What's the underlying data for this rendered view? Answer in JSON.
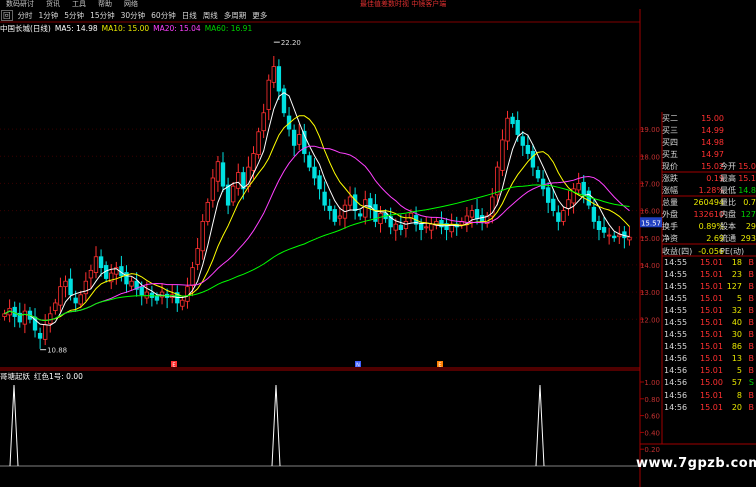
{
  "menubar": {
    "items": [
      "数码研讨",
      "货讯",
      "工具",
      "帮助",
      "网络"
    ],
    "ad_text": "最佳值差数时视 中镜客户端"
  },
  "periodbar": {
    "first": "回",
    "periods": [
      "分时",
      "1分钟",
      "5分钟",
      "15分钟",
      "30分钟",
      "60分钟",
      "日线",
      "周线",
      "多周期",
      "更多"
    ]
  },
  "title": {
    "stock": "中国长城(日线)",
    "ma5": "MA5: 14.98",
    "ma10": "MA10: 15.00",
    "ma20": "MA20: 15.04",
    "ma60": "MA60: 16.91"
  },
  "annotations": {
    "high": "22.20",
    "low": "10.88",
    "current_price_tag": "15.57"
  },
  "price_axis": [
    "19.00",
    "18.00",
    "17.00",
    "16.00",
    "15.00",
    "14.00",
    "13.00",
    "12.00"
  ],
  "indicator": {
    "name": "哥塘起妖",
    "signal": "红色1号: 0.00",
    "axis": [
      "1.00",
      "0.80",
      "0.60",
      "0.40",
      "0.20"
    ]
  },
  "event_marks": [
    "E",
    "N",
    "E"
  ],
  "chart_data": {
    "type": "candlestick",
    "series": [
      {
        "name": "MA5",
        "color": "#ffffff"
      },
      {
        "name": "MA10",
        "color": "#ffff00"
      },
      {
        "name": "MA20",
        "color": "#ff40ff"
      },
      {
        "name": "MA60",
        "color": "#00ff00"
      }
    ],
    "ylim": [
      10.5,
      22.5
    ],
    "closes": [
      12.2,
      12.4,
      12.1,
      11.9,
      12.3,
      12.0,
      11.6,
      11.3,
      11.8,
      12.2,
      12.6,
      13.2,
      13.4,
      12.9,
      12.6,
      12.9,
      13.4,
      13.8,
      14.3,
      13.9,
      13.5,
      13.7,
      13.9,
      13.6,
      13.3,
      13.4,
      13.1,
      12.9,
      13.0,
      12.8,
      12.7,
      13.0,
      12.8,
      12.9,
      12.6,
      12.7,
      13.2,
      13.9,
      14.6,
      15.6,
      16.3,
      17.2,
      17.8,
      16.9,
      16.2,
      16.9,
      17.4,
      16.8,
      17.6,
      18.1,
      18.9,
      19.6,
      20.8,
      21.3,
      20.4,
      19.6,
      19.0,
      18.4,
      18.8,
      18.1,
      17.6,
      17.2,
      16.8,
      16.2,
      16.0,
      15.6,
      15.8,
      16.2,
      16.5,
      16.0,
      15.8,
      16.4,
      16.1,
      15.6,
      15.9,
      15.7,
      15.4,
      15.5,
      15.3,
      15.6,
      15.9,
      15.5,
      15.3,
      15.4,
      15.5,
      15.6,
      15.4,
      15.3,
      15.5,
      15.4,
      15.6,
      15.8,
      16.0,
      15.7,
      15.6,
      15.8,
      16.5,
      17.6,
      18.6,
      19.4,
      19.2,
      18.8,
      18.4,
      18.1,
      17.6,
      17.2,
      16.8,
      16.3,
      16.0,
      15.6,
      16.0,
      16.4,
      16.8,
      17.0,
      16.6,
      16.2,
      15.6,
      15.3,
      15.2,
      15.1,
      15.0,
      15.1,
      15.0,
      15.02
    ],
    "indicator_spikes": [
      3,
      67,
      131
    ]
  },
  "quote": {
    "rows": [
      {
        "l": "买二",
        "v": "15.00",
        "c": "red",
        "l2": "",
        "v2": "",
        "c2": ""
      },
      {
        "l": "买三",
        "v": "14.99",
        "c": "red",
        "l2": "",
        "v2": "",
        "c2": ""
      },
      {
        "l": "买四",
        "v": "14.98",
        "c": "red",
        "l2": "",
        "v2": "",
        "c2": ""
      },
      {
        "l": "买五",
        "v": "14.97",
        "c": "red",
        "l2": "",
        "v2": "",
        "c2": ""
      },
      {
        "l": "现价",
        "v": "15.02",
        "c": "red",
        "l2": "今开",
        "v2": "15.0",
        "c2": "red"
      },
      {
        "l": "涨跌",
        "v": "0.19",
        "c": "red",
        "l2": "最高",
        "v2": "15.1",
        "c2": "red"
      },
      {
        "l": "涨幅",
        "v": "1.28%",
        "c": "red",
        "l2": "最低",
        "v2": "14.8",
        "c2": "green"
      },
      {
        "l": "总量",
        "v": "260494",
        "c": "yellow",
        "l2": "量比",
        "v2": "0.7",
        "c2": "yellow"
      },
      {
        "l": "外盘",
        "v": "132610",
        "c": "red",
        "l2": "内盘",
        "v2": "127",
        "c2": "green"
      },
      {
        "l": "换手",
        "v": "0.89%",
        "c": "yellow",
        "l2": "股本",
        "v2": "29",
        "c2": "yellow"
      },
      {
        "l": "净资",
        "v": "2.69",
        "c": "yellow",
        "l2": "流通",
        "v2": "293",
        "c2": "yellow"
      },
      {
        "l": "收益(四)",
        "v": "-0.056",
        "c": "yellow",
        "l2": "PE(动)",
        "v2": "",
        "c2": ""
      }
    ]
  },
  "ticks": [
    {
      "t": "14:55",
      "p": "15.01",
      "pc": "red",
      "v": "18",
      "bs": "B",
      "bc": "red"
    },
    {
      "t": "14:55",
      "p": "15.01",
      "pc": "red",
      "v": "23",
      "bs": "B",
      "bc": "red"
    },
    {
      "t": "14:55",
      "p": "15.01",
      "pc": "red",
      "v": "127",
      "bs": "B",
      "bc": "red"
    },
    {
      "t": "14:55",
      "p": "15.01",
      "pc": "red",
      "v": "5",
      "bs": "B",
      "bc": "red"
    },
    {
      "t": "14:55",
      "p": "15.01",
      "pc": "red",
      "v": "32",
      "bs": "B",
      "bc": "red"
    },
    {
      "t": "14:55",
      "p": "15.01",
      "pc": "red",
      "v": "40",
      "bs": "B",
      "bc": "red"
    },
    {
      "t": "14:55",
      "p": "15.01",
      "pc": "red",
      "v": "30",
      "bs": "B",
      "bc": "red"
    },
    {
      "t": "14:55",
      "p": "15.01",
      "pc": "red",
      "v": "86",
      "bs": "B",
      "bc": "red"
    },
    {
      "t": "14:56",
      "p": "15.01",
      "pc": "red",
      "v": "13",
      "bs": "B",
      "bc": "red"
    },
    {
      "t": "14:56",
      "p": "15.01",
      "pc": "red",
      "v": "5",
      "bs": "B",
      "bc": "red"
    },
    {
      "t": "14:56",
      "p": "15.00",
      "pc": "red",
      "v": "57",
      "bs": "S",
      "bc": "green"
    },
    {
      "t": "14:56",
      "p": "15.01",
      "pc": "red",
      "v": "8",
      "bs": "B",
      "bc": "red"
    },
    {
      "t": "14:56",
      "p": "15.01",
      "pc": "red",
      "v": "20",
      "bs": "B",
      "bc": "red"
    }
  ],
  "watermark": "www.7gpzb.com"
}
